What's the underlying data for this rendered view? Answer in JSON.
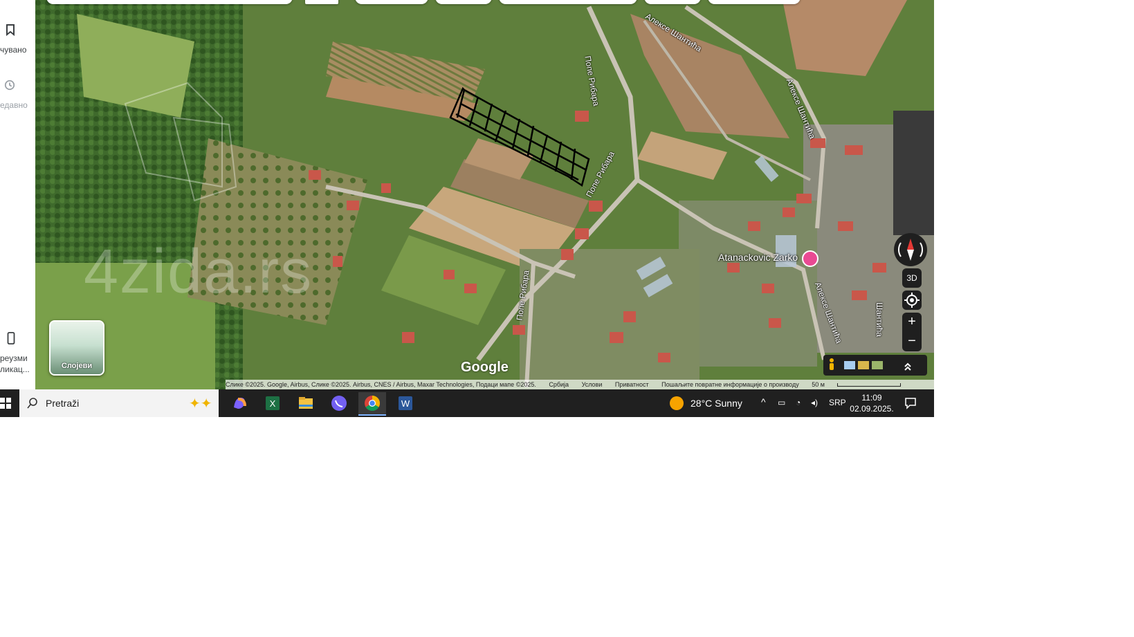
{
  "sidebar": {
    "saved_label": "чувано",
    "recent_label": "едавно",
    "download_label_1": "реузми",
    "download_label_2": "ликац..."
  },
  "map": {
    "watermark": "4zida.rs",
    "layers_label": "Слојеви",
    "place_label": "Atanackovic Zarko",
    "streets": {
      "a": "Алексе Шантића",
      "b": "Алексе Шантића",
      "c": "Попе Рибара",
      "d": "Попе Рибара",
      "e": "Попе Рибара",
      "f": "Алексе Шантића",
      "g": "Шантића"
    },
    "google_logo": "Google",
    "btn_3d": "3D",
    "zoom_in": "+",
    "zoom_out": "−",
    "attribution": {
      "imagery": "Слике ©2025. Google, Airbus, Слике ©2025. Airbus, CNES / Airbus, Maxar Technologies, Подаци мапе ©2025.",
      "country": "Србија",
      "terms": "Услови",
      "privacy": "Приватност",
      "feedback": "Пошаљите повратне информације о производу",
      "scale": "50 м"
    }
  },
  "taskbar": {
    "search_placeholder": "Pretraži",
    "weather_text": "28°C  Sunny",
    "language": "SRP",
    "time": "11:09",
    "date": "02.09.2025."
  },
  "colors": {
    "taskbar_bg": "#202020",
    "map_control_bg": "#1f1f1f",
    "place_pin": "#e94a93"
  }
}
